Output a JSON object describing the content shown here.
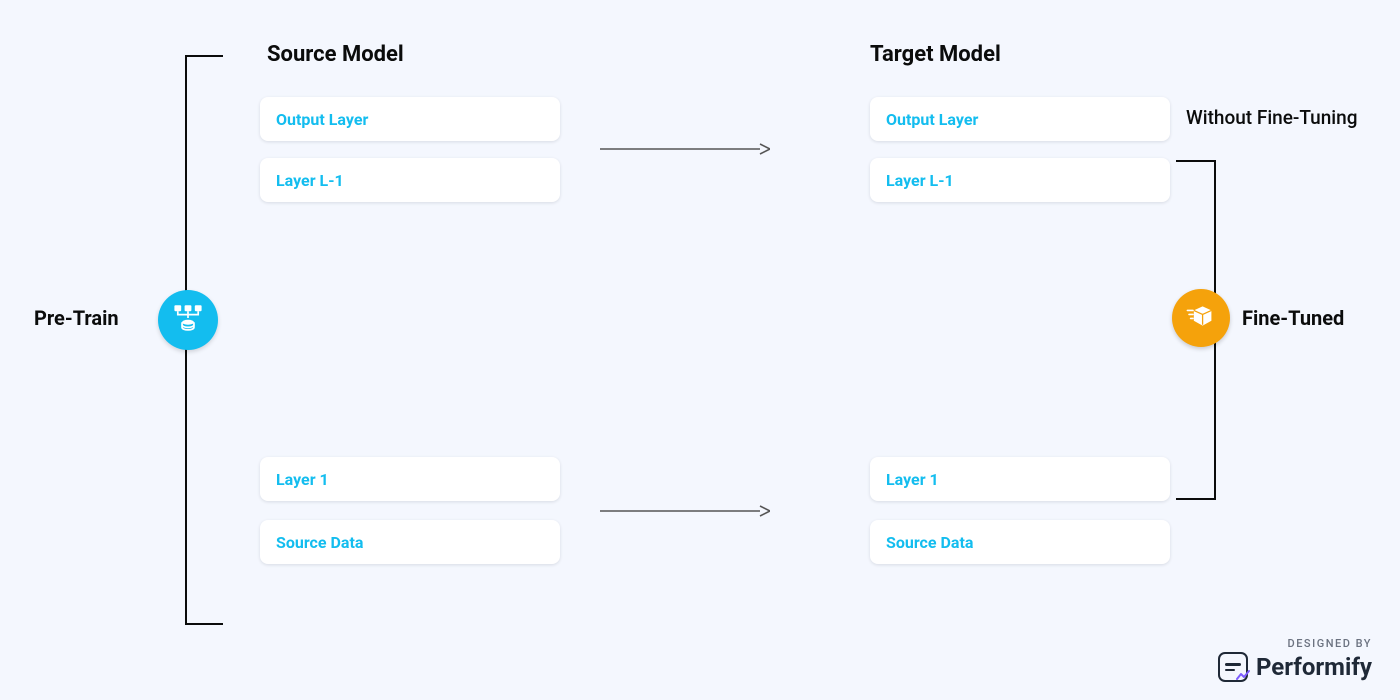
{
  "labels": {
    "pretrain": "Pre-Train",
    "finetuned": "Fine-Tuned",
    "without_ft": "Without Fine-Tuning"
  },
  "source": {
    "title": "Source Model",
    "layers": {
      "output": "Output Layer",
      "lminus1": "Layer L-1",
      "layer1": "Layer 1",
      "data": "Source Data"
    }
  },
  "target": {
    "title": "Target Model",
    "layers": {
      "output": "Output Layer",
      "lminus1": "Layer L-1",
      "layer1": "Layer 1",
      "data": "Source Data"
    }
  },
  "credit": {
    "designed_by": "DESIGNED BY",
    "brand": "Performify"
  },
  "colors": {
    "bg": "#f4f7fe",
    "accent_blue": "#13bdef",
    "accent_orange": "#f5a20b",
    "text": "#0b0c0c"
  }
}
